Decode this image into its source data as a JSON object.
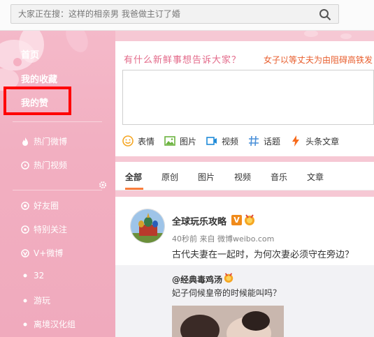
{
  "search": {
    "placeholder": "大家正在搜：这样的相亲男 我爸做主订了婚"
  },
  "nav": {
    "home": "首页",
    "favorites": "我的收藏",
    "likes": "我的赞"
  },
  "subnav": {
    "hot_weibo": "热门微博",
    "hot_video": "热门视频",
    "friends": "好友圈",
    "special": "特别关注",
    "vplus": "V+微博",
    "g32": "32",
    "travel": "游玩",
    "localize": "离境汉化组"
  },
  "publisher": {
    "prompt": "有什么新鲜事想告诉大家？",
    "hot_topic": "女子以等丈夫为由阻碍高铁发",
    "tools": [
      "表情",
      "图片",
      "视频",
      "话题",
      "头条文章"
    ]
  },
  "tabs": [
    "全部",
    "原创",
    "图片",
    "视频",
    "音乐",
    "文章"
  ],
  "post": {
    "username": "全球玩乐攻略",
    "verified": "V",
    "meta": "40秒前 来自 微博weibo.com",
    "text": "古代夫妻在一起时，为何次妻必须守在旁边？",
    "repost_user": "@经典毒鸡汤",
    "repost_text": "妃子伺候皇帝的时候能叫吗？"
  },
  "colors": {
    "accent": "#fa7d3c",
    "sidebar": "#f2afc1",
    "highlight": "#ff0000"
  }
}
